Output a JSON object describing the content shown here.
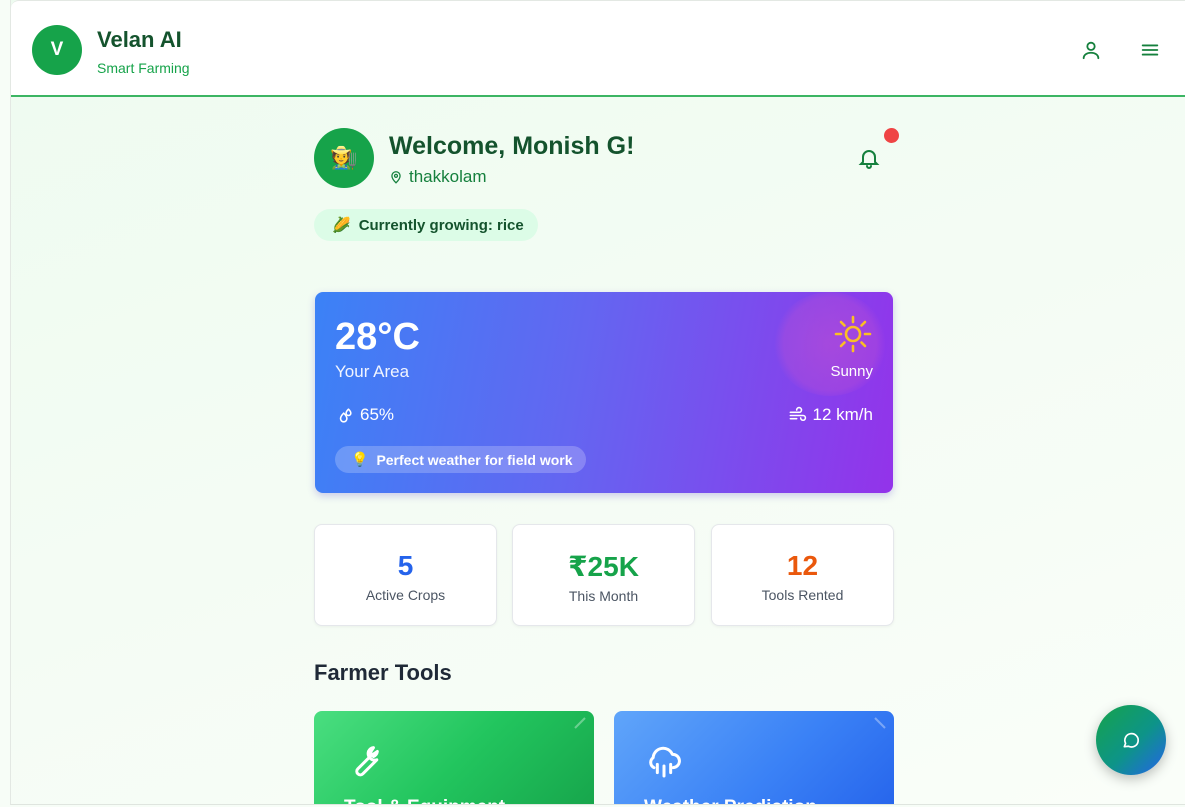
{
  "header": {
    "logo_letter": "V",
    "title": "Velan AI",
    "subtitle": "Smart Farming",
    "profile_icon": "user-icon",
    "menu_icon": "hamburger-menu-icon"
  },
  "welcome": {
    "avatar_emoji": "🧑‍🌾",
    "title": "Welcome, Monish G!",
    "location": "thakkolam",
    "notification_icon": "bell-icon",
    "crop_emoji": "🌽",
    "crop_text": "Currently growing: rice"
  },
  "weather": {
    "temperature": "28°C",
    "area": "Your Area",
    "condition": "Sunny",
    "condition_icon": "sun-icon",
    "humidity": "65%",
    "wind": "12 km/h",
    "tip_emoji": "💡",
    "tip": "Perfect weather for field work"
  },
  "stats": [
    {
      "value": "5",
      "label": "Active Crops",
      "color": "#2563eb"
    },
    {
      "value": "₹25K",
      "label": "This Month",
      "color": "#16a34a"
    },
    {
      "value": "12",
      "label": "Tools Rented",
      "color": "#ea580c"
    }
  ],
  "tools_section": {
    "title": "Farmer Tools",
    "cards": [
      {
        "name": "Tool & Equipment",
        "icon": "wrench-icon"
      },
      {
        "name": "Weather Prediction",
        "icon": "cloud-rain-icon"
      }
    ]
  },
  "chat_button": {
    "icon": "chat-bubble-icon"
  },
  "colors": {
    "brand": "#16a34a",
    "brand_dark": "#14532d",
    "notification": "#ef4444"
  }
}
